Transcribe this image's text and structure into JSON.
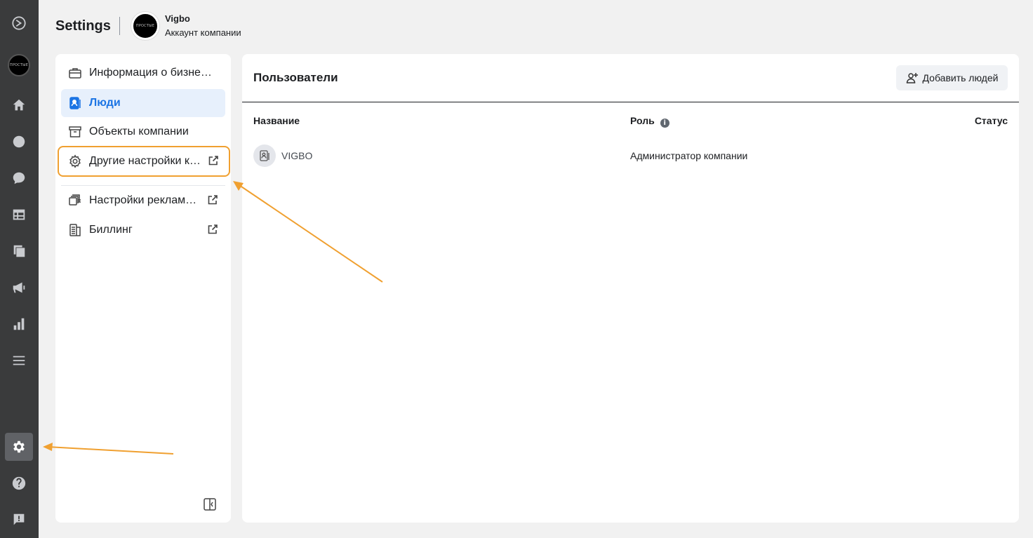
{
  "header": {
    "title": "Settings",
    "account_name": "Vigbo",
    "account_subtitle": "Аккаунт компании",
    "avatar_text": "ПРОСТЫЕ"
  },
  "rail": {
    "items": [
      "logo-icon",
      "account-avatar",
      "home-icon",
      "clock-icon",
      "chat-icon",
      "table-icon",
      "pages-icon",
      "megaphone-icon",
      "bar-chart-icon",
      "menu-icon",
      "gear-icon",
      "help-icon",
      "feedback-icon"
    ],
    "active": "gear-icon"
  },
  "sidebar": {
    "items": [
      {
        "label": "Информация о бизнес…",
        "icon": "briefcase-icon",
        "external": false
      },
      {
        "label": "Люди",
        "icon": "people-badge-icon",
        "external": false,
        "active": true
      },
      {
        "label": "Объекты компании",
        "icon": "archive-box-icon",
        "external": false
      },
      {
        "label": "Другие настройки к…",
        "icon": "gear-outline-icon",
        "external": true,
        "highlighted": true
      },
      {
        "label": "Настройки реклам…",
        "icon": "ad-settings-icon",
        "external": true
      },
      {
        "label": "Биллинг",
        "icon": "billing-icon",
        "external": true
      }
    ]
  },
  "main": {
    "title": "Пользователи",
    "add_button_label": "Добавить людей",
    "columns": {
      "name": "Название",
      "role": "Роль",
      "status": "Статус"
    },
    "rows": [
      {
        "name": "VIGBO",
        "role": "Администратор компании",
        "status": ""
      }
    ]
  },
  "colors": {
    "rail_bg": "#3a3b3c",
    "accent": "#1b74e4",
    "annotation": "#f0a030",
    "page_bg": "#f1f1f1"
  }
}
